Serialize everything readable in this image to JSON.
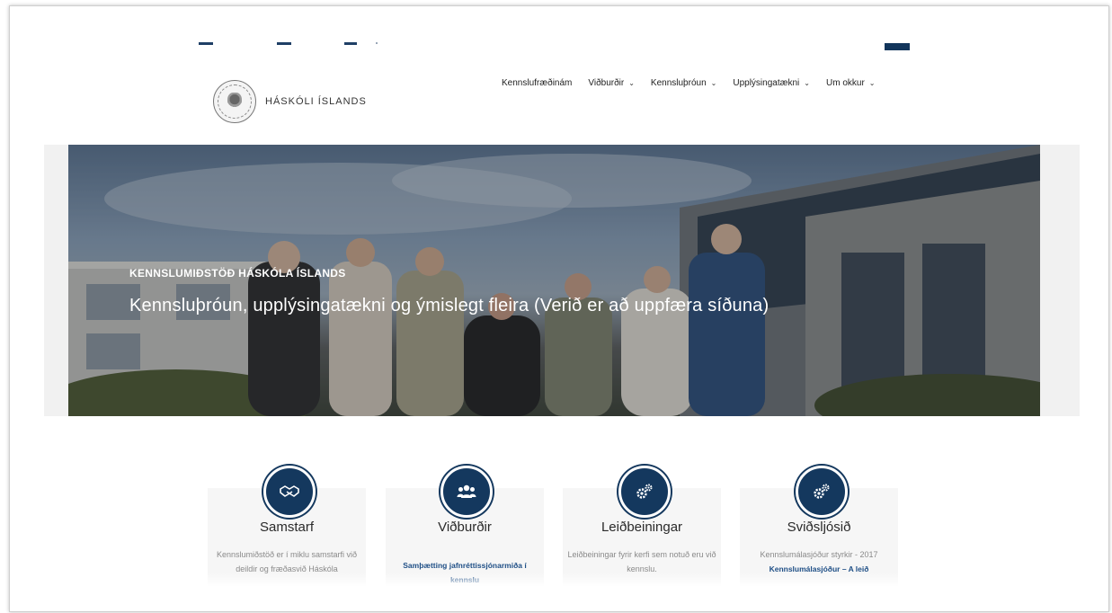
{
  "brand": {
    "name": "HÁSKÓLI ÍSLANDS",
    "accent": "#14385e"
  },
  "nav": {
    "items": [
      {
        "label": "Kennslufræðinám"
      },
      {
        "label": "Viðburðir",
        "chevron": "chevron-down-icon"
      },
      {
        "label": "Kennsluþróun",
        "chevron": "chevron-down-icon"
      },
      {
        "label": "Upplýsingatækni",
        "chevron": "chevron-down-icon"
      },
      {
        "label": "Um okkur",
        "chevron": "chevron-down-icon"
      }
    ]
  },
  "hero": {
    "kicker": "KENNSLUMIÐSTÖÐ HÁSKÓLA ÍSLANDS",
    "title": "Kennsluþróun, upplýsingatækni og ýmislegt fleira (Verið er að uppfæra síðuna)"
  },
  "cards": [
    {
      "icon": "handshake-icon",
      "title": "Samstarf",
      "text": "Kennslumiðstöð er í miklu samstarfi við deildir og fræðasvið Háskóla"
    },
    {
      "icon": "users-icon",
      "title": "Viðburðir",
      "link": "Samþætting jafnréttissjónarmiða í kennslu"
    },
    {
      "icon": "gears-icon",
      "title": "Leiðbeiningar",
      "text": "Leiðbeiningar fyrir kerfi sem notuð eru við kennslu."
    },
    {
      "icon": "gears-icon",
      "title": "Sviðsljósið",
      "text": "Kennslumálasjóður styrkir - 2017",
      "link": "Kennslumálasjóður – A leið"
    }
  ]
}
